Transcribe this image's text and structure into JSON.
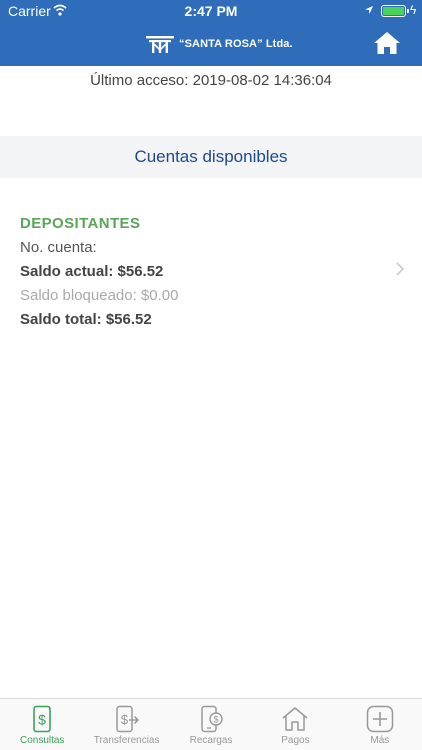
{
  "status_bar": {
    "carrier": "Carrier",
    "time": "2:47 PM",
    "battery_level": 1.0
  },
  "header": {
    "brand": "“SANTA ROSA” Ltda.",
    "logo_icon": "coop-logo-icon",
    "home_icon": "home-icon"
  },
  "last_access": "Último acceso: 2019-08-02 14:36:04",
  "section_title": "Cuentas disponibles",
  "account": {
    "type": "DEPOSITANTES",
    "number": "No. cuenta:",
    "current_balance": "Saldo actual: $56.52",
    "blocked_balance": "Saldo bloqueado: $0.00",
    "total_balance": "Saldo total: $56.52"
  },
  "tabs": [
    {
      "label": "Consultas",
      "icon": "dollar-phone-icon",
      "active": true
    },
    {
      "label": "Transferencias",
      "icon": "transfer-icon",
      "active": false
    },
    {
      "label": "Recargas",
      "icon": "mobile-recharge-icon",
      "active": false
    },
    {
      "label": "Pagos",
      "icon": "house-payment-icon",
      "active": false
    },
    {
      "label": "Más",
      "icon": "plus-icon",
      "active": false
    }
  ],
  "colors": {
    "header": "#2f6dbb",
    "accent_green": "#5aa657",
    "title_blue": "#1f4a8a"
  }
}
